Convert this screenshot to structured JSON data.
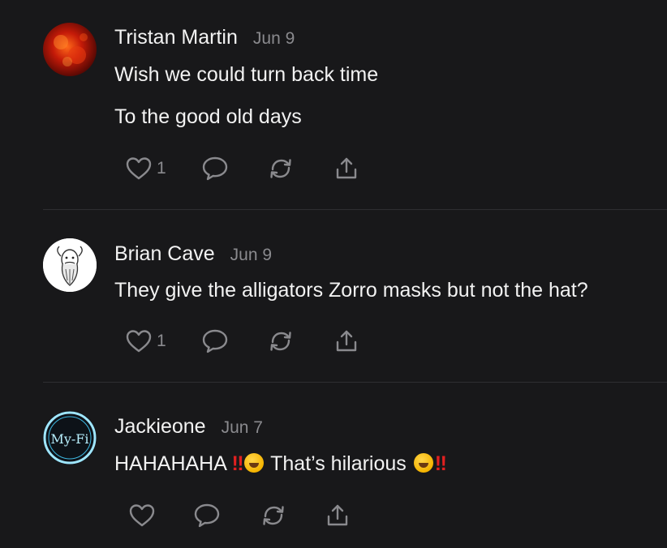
{
  "comments": [
    {
      "author": "Tristan Martin",
      "date": "Jun 9",
      "lines": [
        "Wish we could turn back time",
        "To the good old days"
      ],
      "likes": "1",
      "avatar_icon": "red-nebula-avatar"
    },
    {
      "author": "Brian Cave",
      "date": "Jun 9",
      "lines": [
        "They give the alligators Zorro masks but not the hat?"
      ],
      "likes": "1",
      "avatar_icon": "bearded-man-sketch-avatar"
    },
    {
      "author": "Jackieone",
      "date": "Jun 7",
      "text_a": "HAHAHAHA",
      "bang": "‼",
      "text_b": "That’s hilarious",
      "avatar_text": "My-Fi",
      "avatar_icon": "my-fi-logo-avatar"
    }
  ],
  "icons": {
    "like": "heart-icon",
    "reply": "comment-bubble-icon",
    "restack": "restack-icon",
    "share": "share-icon"
  },
  "colors": {
    "background": "#18181a",
    "text": "#f2f2f2",
    "muted": "#8a8a8e",
    "divider": "#2e2e31",
    "exclamation": "#e02020"
  }
}
